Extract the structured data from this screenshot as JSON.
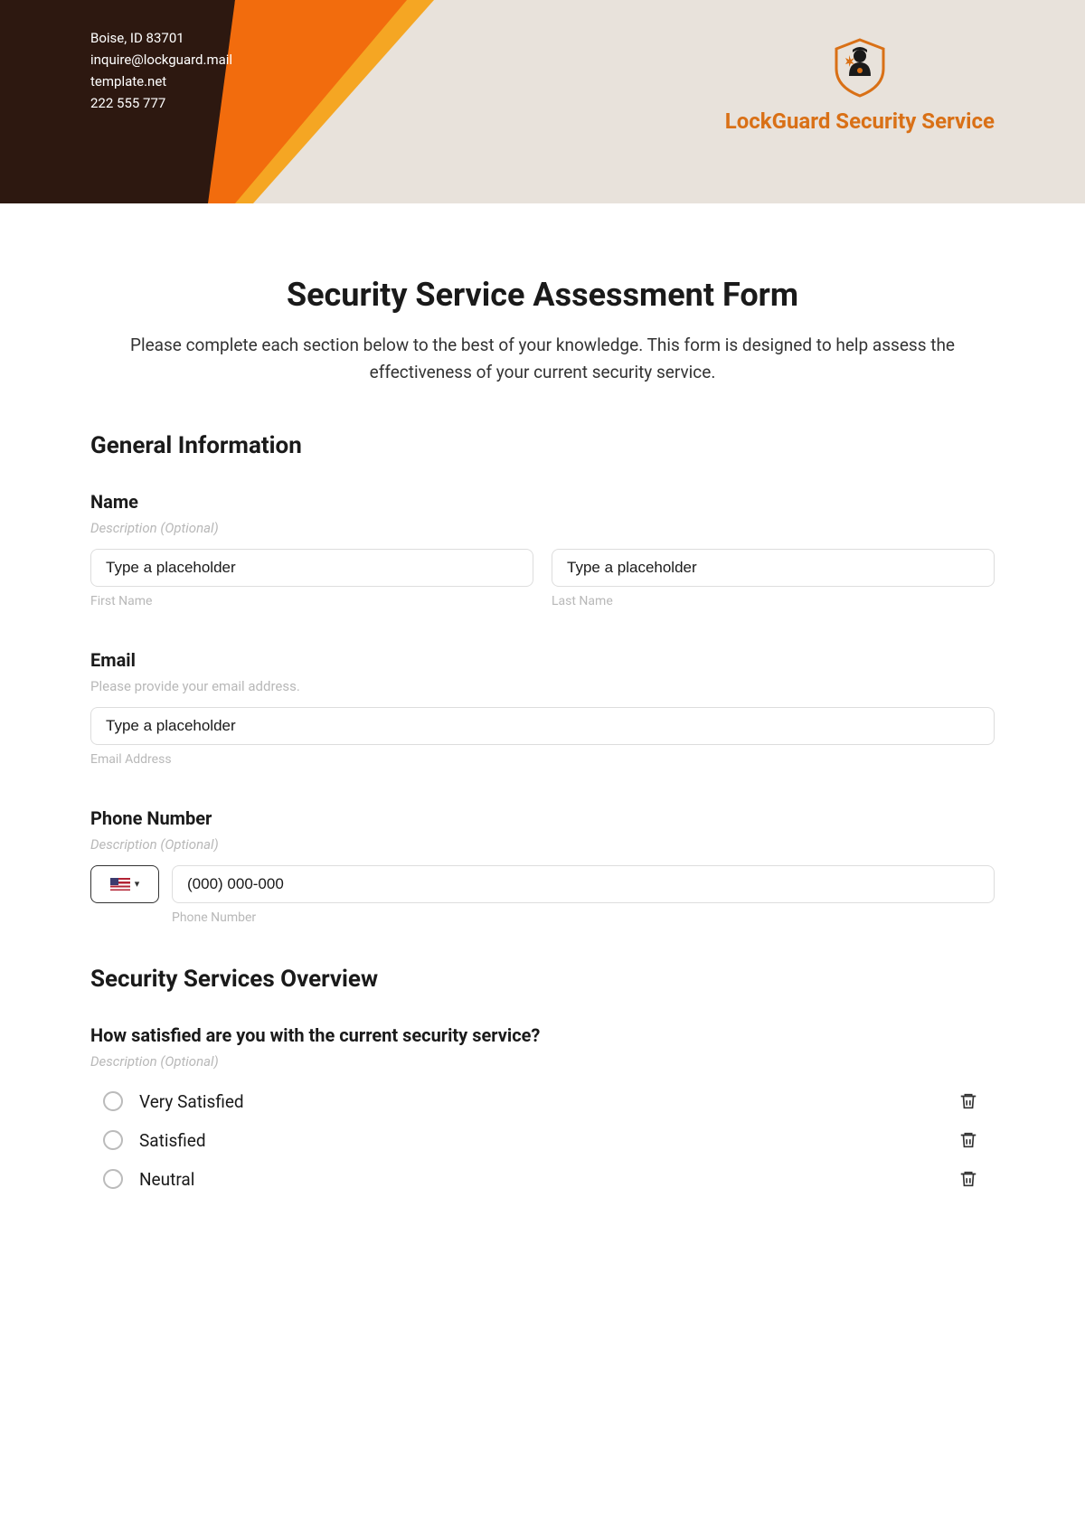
{
  "header": {
    "contact": {
      "address": "Boise, ID 83701",
      "email": "inquire@lockguard.mail",
      "website": "template.net",
      "phone": "222 555 777"
    },
    "company_name": "LockGuard Security Service"
  },
  "form": {
    "title": "Security Service Assessment Form",
    "intro": "Please complete each section below to the best of your knowledge. This form is designed to help assess the effectiveness of your current security service."
  },
  "sections": {
    "general": {
      "heading": "General Information",
      "name": {
        "label": "Name",
        "desc": "Description (Optional)",
        "first_placeholder": "Type a placeholder",
        "first_sublabel": "First Name",
        "last_placeholder": "Type a placeholder",
        "last_sublabel": "Last Name"
      },
      "email": {
        "label": "Email",
        "desc": "Please provide your email address.",
        "placeholder": "Type a placeholder",
        "sublabel": "Email Address"
      },
      "phone": {
        "label": "Phone Number",
        "desc": "Description (Optional)",
        "placeholder": "(000) 000-000",
        "sublabel": "Phone Number"
      }
    },
    "overview": {
      "heading": "Security Services Overview",
      "satisfaction": {
        "question": "How satisfied are you with the current security service?",
        "desc": "Description (Optional)",
        "options": [
          "Very Satisfied",
          "Satisfied",
          "Neutral"
        ]
      }
    }
  }
}
